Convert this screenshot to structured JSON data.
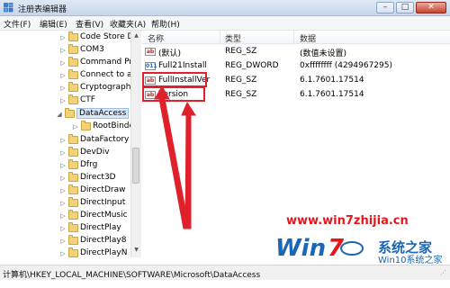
{
  "window": {
    "title": "注册表编辑器",
    "min_glyph": "–",
    "max_glyph": "□",
    "close_glyph": "✕"
  },
  "menu": [
    "文件(F)",
    "编辑(E)",
    "查看(V)",
    "收藏夹(A)",
    "帮助(H)"
  ],
  "tree": {
    "items": [
      {
        "label": "Code Store D",
        "expander": "▷"
      },
      {
        "label": "COM3",
        "expander": "▷"
      },
      {
        "label": "Command Pr",
        "expander": "▷"
      },
      {
        "label": "Connect to a",
        "expander": "▷"
      },
      {
        "label": "Cryptograph",
        "expander": "▷"
      },
      {
        "label": "CTF",
        "expander": "▷"
      },
      {
        "label": "DataAccess",
        "expander": "◢",
        "selected": true
      },
      {
        "label": "RootBinde",
        "expander": "▷",
        "child": true
      },
      {
        "label": "DataFactory",
        "expander": "▷"
      },
      {
        "label": "DevDiv",
        "expander": "▷"
      },
      {
        "label": "Dfrg",
        "expander": "▷"
      },
      {
        "label": "Direct3D",
        "expander": "▷"
      },
      {
        "label": "DirectDraw",
        "expander": "▷"
      },
      {
        "label": "DirectInput",
        "expander": "▷"
      },
      {
        "label": "DirectMusic",
        "expander": "▷"
      },
      {
        "label": "DirectPlay",
        "expander": "▷"
      },
      {
        "label": "DirectPlay8",
        "expander": "▷"
      },
      {
        "label": "DirectPlayN",
        "expander": "▷"
      }
    ],
    "scroll_up": "▲",
    "scroll_down": "▼"
  },
  "list": {
    "headers": {
      "name": "名称",
      "type": "类型",
      "data": "数据"
    },
    "rows": [
      {
        "icon": "ab",
        "name": "(默认)",
        "type": "REG_SZ",
        "data": "(数值未设置)"
      },
      {
        "icon": "011",
        "name": "Full21Install",
        "type": "REG_DWORD",
        "data": "0xffffffff (4294967295)"
      },
      {
        "icon": "ab",
        "name": "FullInstallVer",
        "type": "REG_SZ",
        "data": "6.1.7601.17514"
      },
      {
        "icon": "ab",
        "name": "Version",
        "type": "REG_SZ",
        "data": "6.1.7601.17514"
      }
    ]
  },
  "status": {
    "path": "计算机\\HKEY_LOCAL_MACHINE\\SOFTWARE\\Microsoft\\DataAccess",
    "grip": "⋰"
  },
  "watermark": {
    "url": "www.win7zhijia.cn",
    "brand": "系统之家",
    "domain": "Win10系统之家"
  },
  "colors": {
    "highlight": "#e0202a",
    "watermark_red": "#e5161c",
    "watermark_blue": "#1b67b3"
  }
}
